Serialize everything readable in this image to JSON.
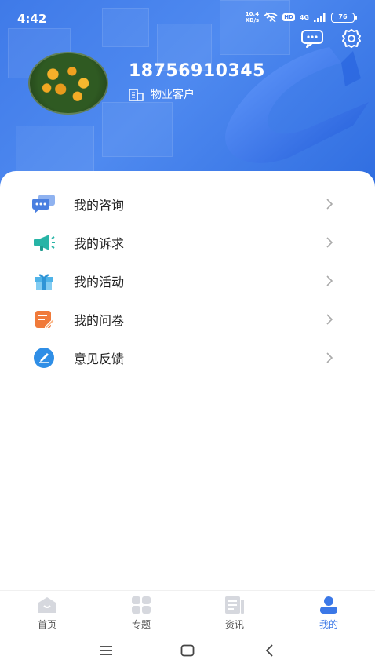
{
  "status_bar": {
    "time": "4:42",
    "net_speed_value": "10.4",
    "net_speed_unit": "KB/s",
    "hd": "HD",
    "network": "4G",
    "battery": "76"
  },
  "profile": {
    "phone": "18756910345",
    "role": "物业客户"
  },
  "header_icons": [
    "message-icon",
    "settings-gear-icon"
  ],
  "menu": {
    "items": [
      {
        "label": "我的咨询",
        "icon": "consult-chat-icon",
        "color": "#4a7fe0"
      },
      {
        "label": "我的诉求",
        "icon": "megaphone-icon",
        "color": "#27b4a6"
      },
      {
        "label": "我的活动",
        "icon": "gift-icon",
        "color": "#4fb3e8"
      },
      {
        "label": "我的问卷",
        "icon": "survey-edit-icon",
        "color": "#f07a3a"
      },
      {
        "label": "意见反馈",
        "icon": "feedback-pen-icon",
        "color": "#2f8ee6"
      }
    ]
  },
  "bottom_nav": {
    "items": [
      {
        "label": "首页",
        "icon": "home-icon",
        "active": false
      },
      {
        "label": "专题",
        "icon": "topics-grid-icon",
        "active": false
      },
      {
        "label": "资讯",
        "icon": "news-icon",
        "active": false
      },
      {
        "label": "我的",
        "icon": "profile-icon",
        "active": true
      }
    ]
  },
  "colors": {
    "header_blue": "#3f7ae8",
    "accent": "#3b78e7",
    "text": "#222222"
  }
}
